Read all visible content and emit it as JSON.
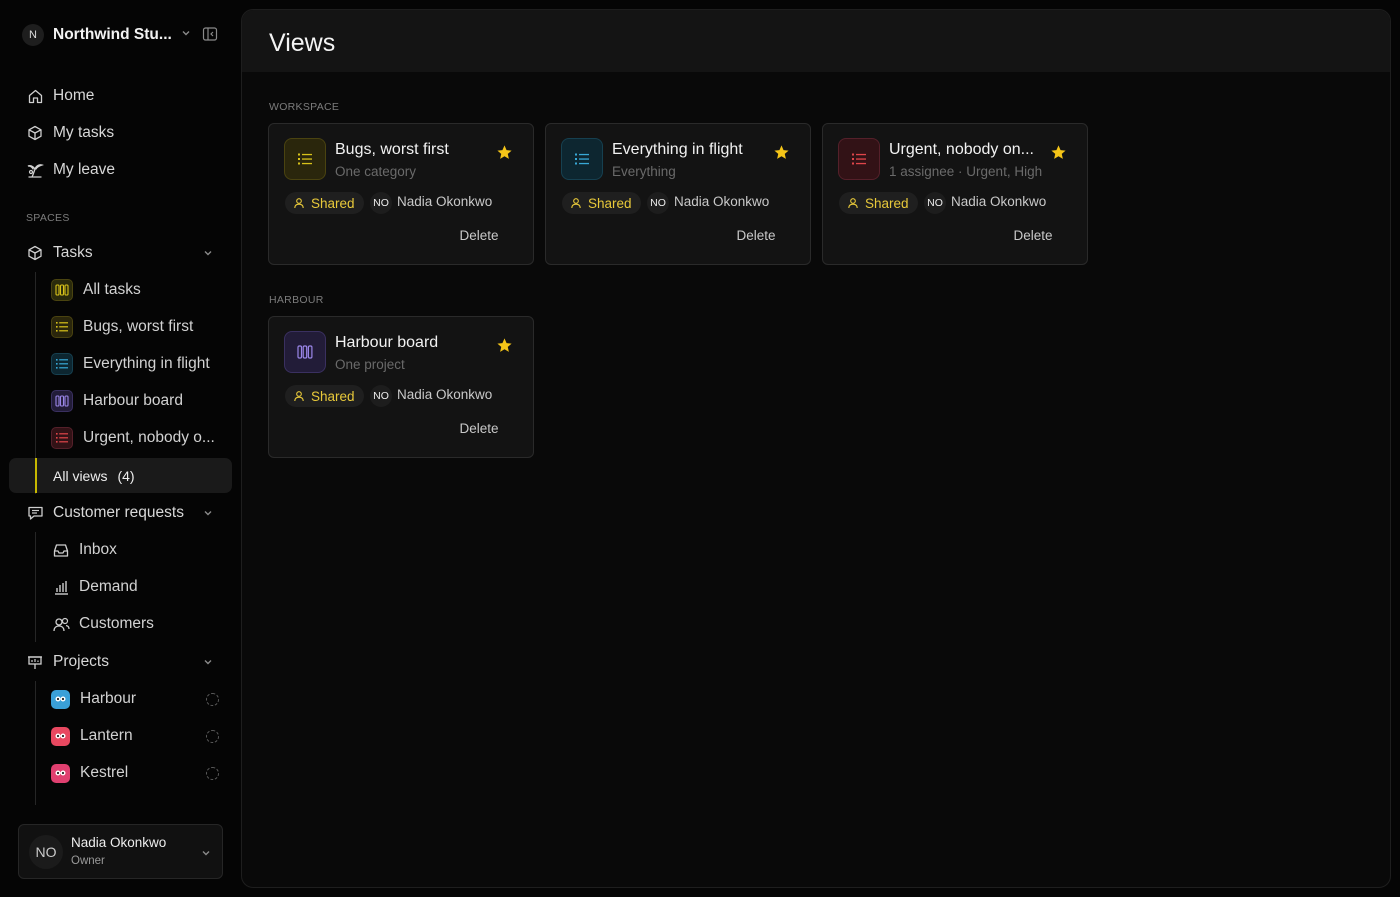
{
  "workspace": {
    "initial": "N",
    "name": "Northwind Stu..."
  },
  "nav": [
    {
      "label": "Home",
      "icon": "home-icon"
    },
    {
      "label": "My tasks",
      "icon": "cube-icon"
    },
    {
      "label": "My leave",
      "icon": "palm-tree-icon"
    }
  ],
  "spaces_label": "SPACES",
  "tasks_group": {
    "label": "Tasks",
    "items": [
      {
        "label": "All tasks",
        "icon": "board-icon",
        "color": "#d8c21a",
        "bg": "#2a2a0c"
      },
      {
        "label": "Bugs, worst first",
        "icon": "list-icon",
        "color": "#d8c21a",
        "bg": "#2a260c"
      },
      {
        "label": "Everything in flight",
        "icon": "list-icon",
        "color": "#38a8d6",
        "bg": "#0d2630"
      },
      {
        "label": "Harbour board",
        "icon": "board-icon",
        "color": "#9a86e8",
        "bg": "#221c38"
      },
      {
        "label": "Urgent, nobody o...",
        "icon": "list-icon",
        "color": "#e0454a",
        "bg": "#321216"
      }
    ],
    "all_views_label": "All views",
    "all_views_count": "(4)"
  },
  "requests_group": {
    "label": "Customer requests",
    "items": [
      {
        "label": "Inbox",
        "icon": "inbox-icon"
      },
      {
        "label": "Demand",
        "icon": "bar-chart-icon"
      },
      {
        "label": "Customers",
        "icon": "users-icon"
      }
    ]
  },
  "projects_group": {
    "label": "Projects",
    "items": [
      {
        "label": "Harbour",
        "color": "#3aa0d8"
      },
      {
        "label": "Lantern",
        "color": "#e84860"
      },
      {
        "label": "Kestrel",
        "color": "#e04070"
      }
    ]
  },
  "user": {
    "initials": "NO",
    "name": "Nadia Okonkwo",
    "role": "Owner"
  },
  "page": {
    "title": "Views"
  },
  "sections": {
    "workspace": {
      "label": "WORKSPACE",
      "cards": [
        {
          "title": "Bugs, worst first",
          "subtitle": "One category",
          "badge": "Shared",
          "owner_initials": "NO",
          "owner": "Nadia Okonkwo",
          "delete": "Delete",
          "color": "#d8c21a",
          "bg": "#2a260c",
          "border": "#4a4310"
        },
        {
          "title": "Everything in flight",
          "subtitle": "Everything",
          "badge": "Shared",
          "owner_initials": "NO",
          "owner": "Nadia Okonkwo",
          "delete": "Delete",
          "color": "#38a8d6",
          "bg": "#0d2630",
          "border": "#164050"
        },
        {
          "title": "Urgent, nobody on...",
          "subtitle": "1 assignee · Urgent, High",
          "badge": "Shared",
          "owner_initials": "NO",
          "owner": "Nadia Okonkwo",
          "delete": "Delete",
          "color": "#e0454a",
          "bg": "#321216",
          "border": "#55202a"
        }
      ]
    },
    "harbour": {
      "label": "HARBOUR",
      "cards": [
        {
          "title": "Harbour board",
          "subtitle": "One project",
          "badge": "Shared",
          "owner_initials": "NO",
          "owner": "Nadia Okonkwo",
          "delete": "Delete",
          "color": "#9a86e8",
          "bg": "#221c38",
          "border": "#3a3060"
        }
      ]
    }
  },
  "colors": {
    "star": "#f5c518",
    "accent_bar": "#c7b800"
  }
}
